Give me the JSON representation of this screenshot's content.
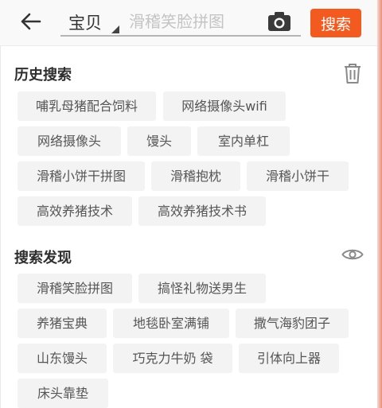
{
  "header": {
    "category": "宝贝",
    "search_placeholder": "滑稽笑脸拼图",
    "search_button": "搜索"
  },
  "history": {
    "title": "历史搜索",
    "items": [
      "哺乳母猪配合饲料",
      "网络摄像头wifi",
      "网络摄像头",
      "馒头",
      "室内单杠",
      "滑稽小饼干拼图",
      "滑稽抱枕",
      "滑稽小饼干",
      "高效养猪技术",
      "高效养猪技术书"
    ]
  },
  "discover": {
    "title": "搜索发现",
    "items": [
      "滑稽笑脸拼图",
      "搞怪礼物送男生",
      "养猪宝典",
      "地毯卧室满铺",
      "撒气海豹团子",
      "山东馒头",
      "巧克力牛奶 袋",
      "引体向上器",
      "床头靠垫"
    ]
  },
  "colors": {
    "accent": "#f35a1f",
    "chip_bg": "#f3f3f3",
    "chip_text": "#555555"
  },
  "icons": [
    "back-arrow-icon",
    "caret-icon",
    "camera-icon",
    "trash-icon",
    "eye-icon"
  ]
}
